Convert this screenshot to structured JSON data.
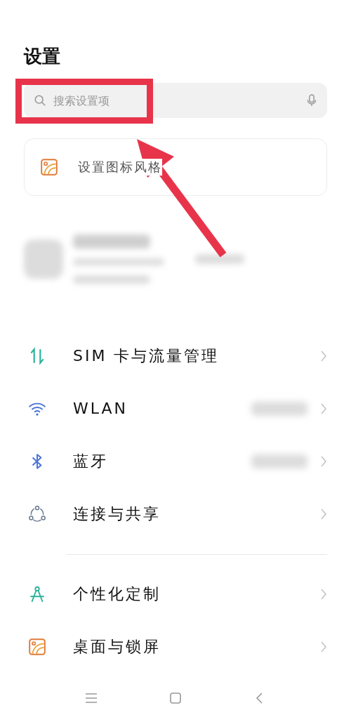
{
  "title": "设置",
  "search": {
    "placeholder": "搜索设置项"
  },
  "suggestion": {
    "label": "设置图标风格"
  },
  "groups": [
    {
      "items": [
        {
          "kind": "sim",
          "label": "SIM 卡与流量管理",
          "blurred_value": false
        },
        {
          "kind": "wifi",
          "label": "WLAN",
          "blurred_value": true
        },
        {
          "kind": "bluetooth",
          "label": "蓝牙",
          "blurred_value": true
        },
        {
          "kind": "share",
          "label": "连接与共享",
          "blurred_value": false
        }
      ]
    },
    {
      "items": [
        {
          "kind": "compass",
          "label": "个性化定制",
          "blurred_value": false
        },
        {
          "kind": "wallpaper",
          "label": "桌面与锁屏",
          "blurred_value": false
        }
      ]
    }
  ]
}
